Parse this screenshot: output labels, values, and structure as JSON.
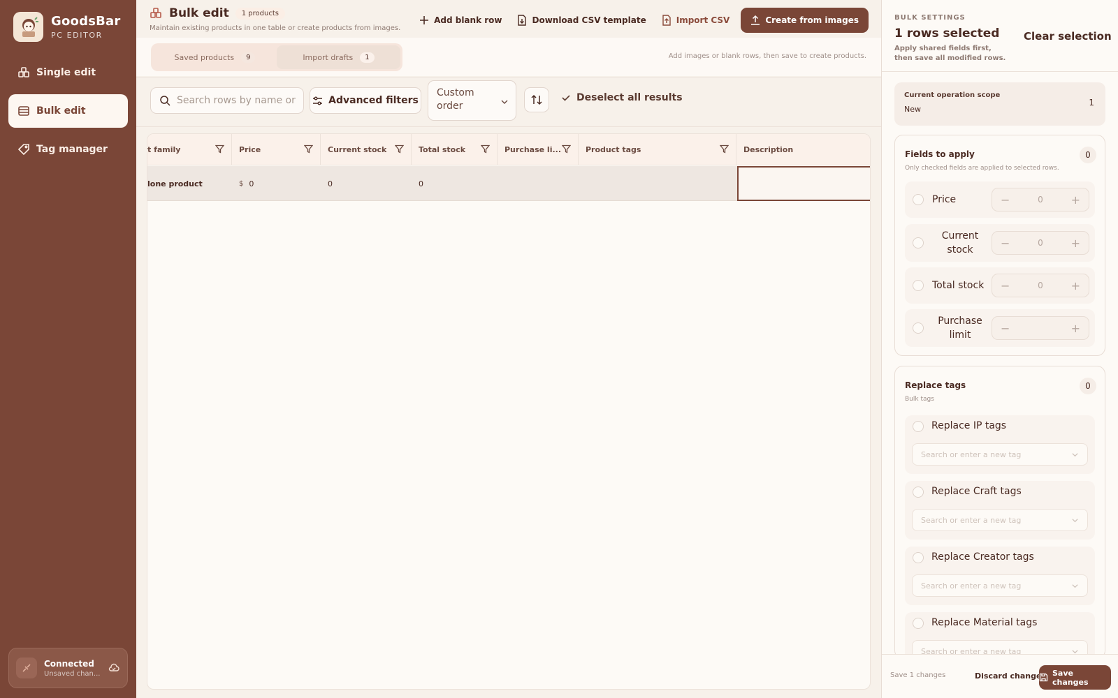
{
  "app": {
    "name": "GoodsBar",
    "subtitle": "PC EDITOR"
  },
  "sidebar": {
    "items": [
      {
        "label": "Single edit",
        "icon": "box-icon",
        "active": false
      },
      {
        "label": "Bulk edit",
        "icon": "table-icon",
        "active": true
      },
      {
        "label": "Tag manager",
        "icon": "tag-icon",
        "active": false
      }
    ],
    "status": {
      "title": "Connected",
      "sub": "Unsaved chan..."
    }
  },
  "header": {
    "title": "Bulk edit",
    "count_badge": "1 products",
    "subtitle": "Maintain existing products in one table or create products from images.",
    "actions": {
      "add_blank_row": "Add blank row",
      "download_csv": "Download CSV template",
      "import_csv": "Import CSV",
      "create_from_images": "Create from images"
    }
  },
  "tabs": [
    {
      "label": "Saved products",
      "count": "9"
    },
    {
      "label": "Import drafts",
      "count": "1"
    }
  ],
  "tabs_hint": "Add images or blank rows, then save to create products.",
  "toolbar": {
    "search_placeholder": "Search rows by name or ta",
    "advanced_filters": "Advanced filters",
    "sort_select": "Custom order",
    "deselect": "Deselect all results"
  },
  "table": {
    "columns": [
      "t family",
      "Price",
      "Current stock",
      "Total stock",
      "Purchase li...",
      "Product tags",
      "Description"
    ],
    "rows": [
      {
        "family": "lone product",
        "currency": "$",
        "price": "0",
        "current_stock": "0",
        "total_stock": "0",
        "purchase_limit": "",
        "tags": "",
        "description": ""
      }
    ]
  },
  "panel": {
    "kicker": "BULK SETTINGS",
    "title": "1 rows selected",
    "subtitle": "Apply shared fields first, then save all modified rows.",
    "clear": "Clear selection",
    "scope": {
      "label": "Current operation scope",
      "value": "New",
      "count": "1"
    },
    "fields": {
      "title": "Fields to apply",
      "sub": "Only checked fields are applied to selected rows.",
      "count": "0",
      "items": [
        {
          "label": "Price",
          "value": "0"
        },
        {
          "label": "Current stock",
          "value": "0"
        },
        {
          "label": "Total stock",
          "value": "0"
        },
        {
          "label": "Purchase limit",
          "value": ""
        }
      ]
    },
    "tags": {
      "title": "Replace tags",
      "sub": "Bulk tags",
      "count": "0",
      "placeholder": "Search or enter a new tag",
      "items": [
        {
          "label": "Replace IP tags"
        },
        {
          "label": "Replace Craft tags"
        },
        {
          "label": "Replace Creator tags"
        },
        {
          "label": "Replace Material tags"
        }
      ]
    },
    "footer": {
      "note": "Save 1 changes",
      "discard": "Discard changes",
      "save": "Save changes"
    }
  }
}
